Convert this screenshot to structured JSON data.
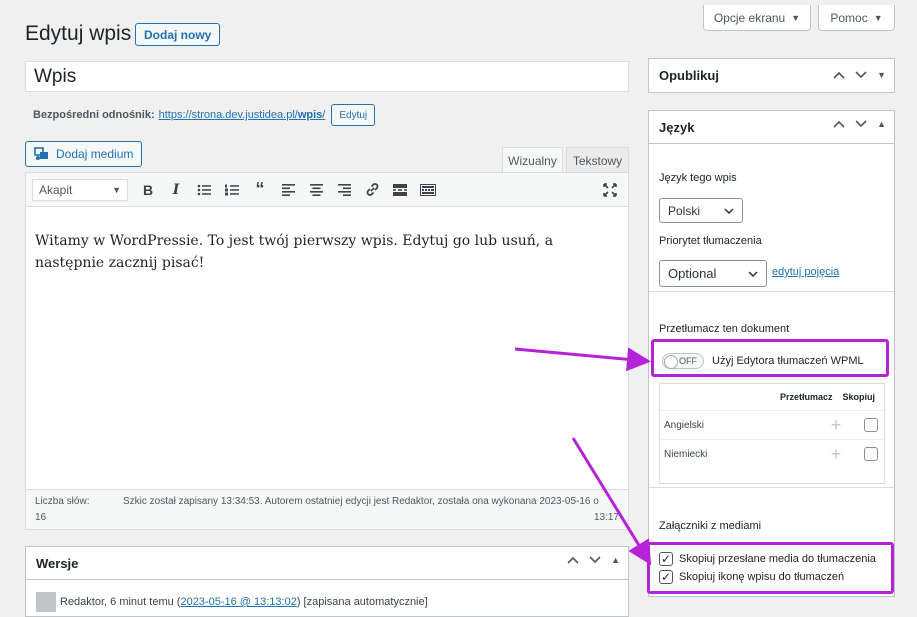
{
  "screen_options": {
    "label": "Opcje ekranu"
  },
  "help": {
    "label": "Pomoc"
  },
  "page": {
    "title": "Edytuj wpis",
    "add_new": "Dodaj nowy"
  },
  "post": {
    "title": "Wpis",
    "permalink_label": "Bezpośredni odnośnik:",
    "permalink_base": "https://strona.dev.justidea.pl/",
    "permalink_slug": "wpis",
    "permalink_end": "/",
    "permalink_edit": "Edytuj"
  },
  "editor": {
    "add_media": "Dodaj medium",
    "tab_visual": "Wizualny",
    "tab_text": "Tekstowy",
    "format_select": "Akapit",
    "content": "Witamy w WordPressie. To jest twój pierwszy wpis. Edytuj go lub usuń, a następnie zacznij pisać!",
    "word_count_label": "Liczba słów:",
    "word_count": "16",
    "autosave_text": "Szkic został zapisany 13:34:53. Autorem ostatniej edycji jest Redaktor, została ona wykonana 2023-05-16 o",
    "autosave_time": "13:17"
  },
  "revisions": {
    "title": "Wersje",
    "author": "Redaktor, 6 minut temu (",
    "link": "2023-05-16 @ 13:13:02",
    "suffix": ") [zapisana automatycznie]"
  },
  "publish": {
    "title": "Opublikuj"
  },
  "language": {
    "title": "Język",
    "lang_label": "Język tego wpis",
    "lang_value": "Polski",
    "priority_label": "Priorytet tłumaczenia",
    "priority_value": "Optional",
    "edit_terms": "edytuj pojęcia",
    "translate_label": "Przetłumacz ten dokument",
    "toggle": "OFF",
    "wpml_label": "Użyj Edytora tłumaczeń WPML",
    "col_translate": "Przetłumacz",
    "col_copy": "Skopiuj",
    "rows": [
      {
        "name": "Angielski"
      },
      {
        "name": "Niemiecki"
      }
    ],
    "media_label": "Załączniki z mediami",
    "copy_media": "Skopiuj przesłane media do tłumaczenia",
    "copy_featured": "Skopiuj ikonę wpisu do tłumaczeń"
  },
  "colors": {
    "highlight": "#b522d8",
    "link": "#2271b1"
  }
}
